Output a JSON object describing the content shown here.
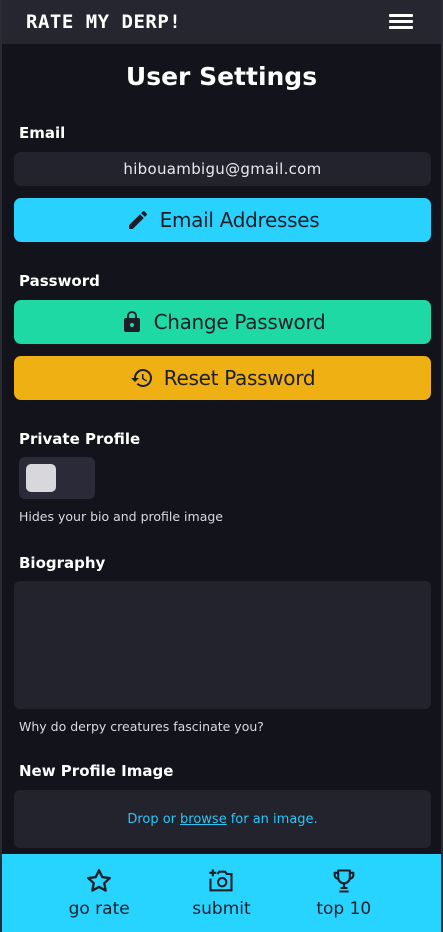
{
  "header": {
    "logo": "RATE MY DERP!",
    "menu_icon": "hamburger-menu-icon"
  },
  "page": {
    "title": "User Settings"
  },
  "email": {
    "label": "Email",
    "value": "hibouambigu@gmail.com",
    "button_label": "Email Addresses",
    "button_icon": "pencil-icon",
    "button_color": "#29d1ff"
  },
  "password": {
    "label": "Password",
    "change_label": "Change Password",
    "change_icon": "lock-icon",
    "change_color": "#1fd9a5",
    "reset_label": "Reset Password",
    "reset_icon": "history-icon",
    "reset_color": "#eeb013"
  },
  "private_profile": {
    "label": "Private Profile",
    "enabled": false,
    "hint": "Hides your bio and profile image"
  },
  "biography": {
    "label": "Biography",
    "value": "",
    "hint": "Why do derpy creatures fascinate you?"
  },
  "profile_image": {
    "label": "New Profile Image",
    "drop_prefix": "Drop or",
    "browse_link": "browse",
    "drop_suffix": "for an image."
  },
  "bottom_nav": {
    "items": [
      {
        "label": "go rate",
        "icon": "star-icon"
      },
      {
        "label": "submit",
        "icon": "camera-plus-icon"
      },
      {
        "label": "top 10",
        "icon": "trophy-icon"
      }
    ]
  }
}
